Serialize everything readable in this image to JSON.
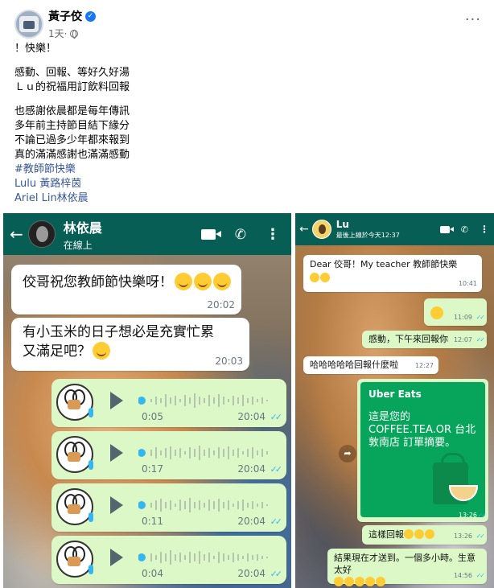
{
  "post": {
    "author": "黃子佼",
    "timestamp": "1天",
    "lines": [
      "！快樂！",
      "",
      "感動、回報、等好久好湯",
      "Ｌｕ的祝福用訂飲料回報",
      "",
      "也感謝依晨都是每年傳訊",
      "多年前主持節目結下緣分",
      "不論已過多少年都來報到",
      "真的滿滿感謝也滿滿感動"
    ],
    "hashtag": "#教師節快樂",
    "mentions": [
      "Lulu 黃路梓茵",
      "Ariel Lin林依晨"
    ]
  },
  "left_chat": {
    "contact_name": "林依晨",
    "status": "在線上",
    "messages": [
      {
        "text": "佼哥祝您教師節快樂呀！",
        "time": "20:02"
      },
      {
        "text": "有小玉米的日子想必是充實忙累又滿足吧？",
        "time": "20:03"
      }
    ],
    "voice_notes": [
      {
        "duration": "0:05",
        "time": "20:04"
      },
      {
        "duration": "0:17",
        "time": "20:04"
      },
      {
        "duration": "0:11",
        "time": "20:04"
      },
      {
        "duration": "0:04",
        "time": "20:04"
      }
    ]
  },
  "right_chat": {
    "contact_name": "Lu",
    "status": "最後上線於今天12:37",
    "messages": [
      {
        "text": "Dear 佼哥！My teacher 教師節快樂",
        "time": "10:41"
      },
      {
        "text": "",
        "time": "11:09"
      },
      {
        "text": "感動，下午來回報你",
        "time": "12:07"
      },
      {
        "text": "哈哈哈哈哈回報什麼啦",
        "time": "12:27"
      },
      {
        "text": "這樣回報",
        "time": "13:26"
      },
      {
        "text": "結果現在才送到。一個多小時。生意太好",
        "time": "14:56"
      }
    ],
    "uber_card": {
      "brand": "Uber Eats",
      "text": "這是您的 COFFEE.TEA.OR 台北敦南店 訂單摘要。",
      "time": "13:26"
    }
  },
  "colors": {
    "wa_header": "#075e54",
    "outgoing_bubble": "#dcf8c6",
    "link": "#385898",
    "uber_green": "#07a55b"
  }
}
